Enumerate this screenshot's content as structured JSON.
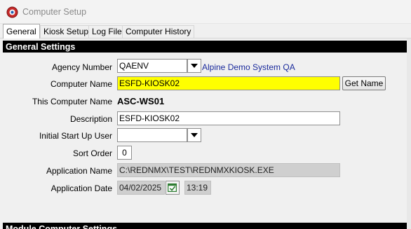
{
  "window": {
    "title": "Computer Setup"
  },
  "tabs": [
    {
      "label": "General"
    },
    {
      "label": "Kiosk Setup"
    },
    {
      "label": "Log File"
    },
    {
      "label": "Computer History"
    }
  ],
  "general_settings": {
    "header": "General Settings",
    "agency_number": {
      "label": "Agency Number",
      "value": "QAENV",
      "agency_name": "Alpine Demo System QA"
    },
    "computer_name": {
      "label": "Computer Name",
      "value": "ESFD-KIOSK02",
      "button": "Get Name"
    },
    "this_computer_name": {
      "label": "This Computer Name",
      "value": "ASC-WS01"
    },
    "description": {
      "label": "Description",
      "value": "ESFD-KIOSK02"
    },
    "initial_user": {
      "label": "Initial Start Up User",
      "value": ""
    },
    "sort_order": {
      "label": "Sort Order",
      "value": "0"
    },
    "application_name": {
      "label": "Application Name",
      "value": "C:\\REDNMX\\TEST\\REDNMXKIOSK.EXE"
    },
    "application_date": {
      "label": "Application Date",
      "date": "04/02/2025",
      "time": "13:19"
    }
  },
  "module_settings": {
    "header": "Module Computer Settings"
  },
  "colors": {
    "highlight": "#ffff00",
    "agency_link": "#1a2a9c",
    "header_bg": "#000000"
  },
  "icons": {
    "app": "app-logo-icon",
    "dropdown": "chevron-down-icon",
    "calendar": "calendar-icon"
  }
}
